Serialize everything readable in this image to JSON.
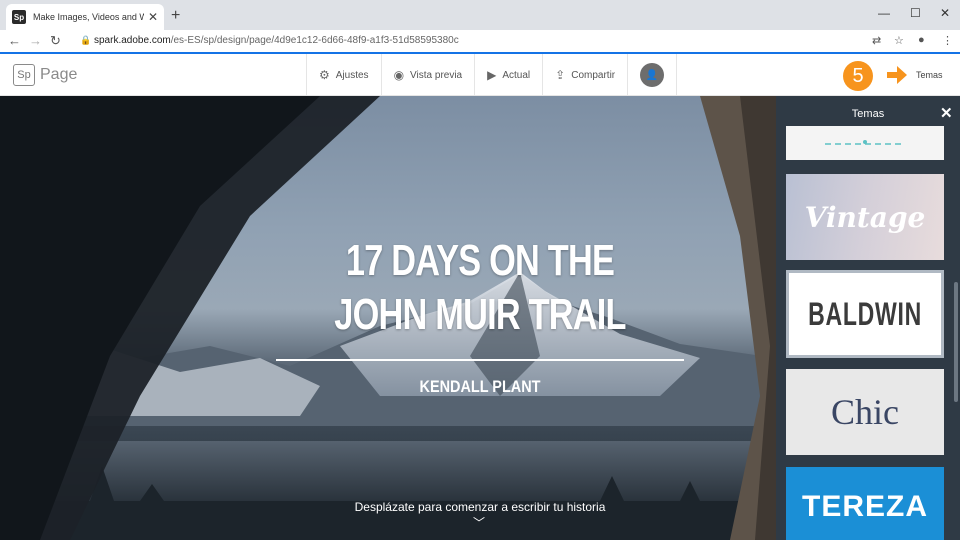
{
  "browser": {
    "tab_title": "Make Images, Videos and Web S",
    "favicon_text": "Sp",
    "new_tab_icon": "plus-icon",
    "url_host": "spark.adobe.com",
    "url_path": "/es-ES/sp/design/page/4d9e1c12-6d66-48f9-a1f3-51d58595380c"
  },
  "app": {
    "logo_text": "Sp",
    "app_name": "Page",
    "toolbar": [
      {
        "label": "Ajustes",
        "icon": "gear-icon"
      },
      {
        "label": "Vista previa",
        "icon": "eye-icon"
      },
      {
        "label": "Actual",
        "icon": "play-icon"
      },
      {
        "label": "Compartir",
        "icon": "share-icon"
      }
    ],
    "step_number": "5",
    "themes_label": "Temas"
  },
  "hero": {
    "title": "17 DAYS ON THE JOHN MUIR TRAIL",
    "author": "KENDALL PLANT",
    "scroll_hint": "Desplázate para comenzar a escribir tu historia"
  },
  "themes_panel": {
    "title": "Temas",
    "themes": [
      "Vintage",
      "BALDWIN",
      "Chic",
      "TEREZA"
    ],
    "selected": "BALDWIN"
  },
  "colors": {
    "accent_blue": "#1473e6",
    "step_orange": "#f7941d",
    "panel_bg": "#2f3a45",
    "tereza_blue": "#1b8fd6"
  }
}
